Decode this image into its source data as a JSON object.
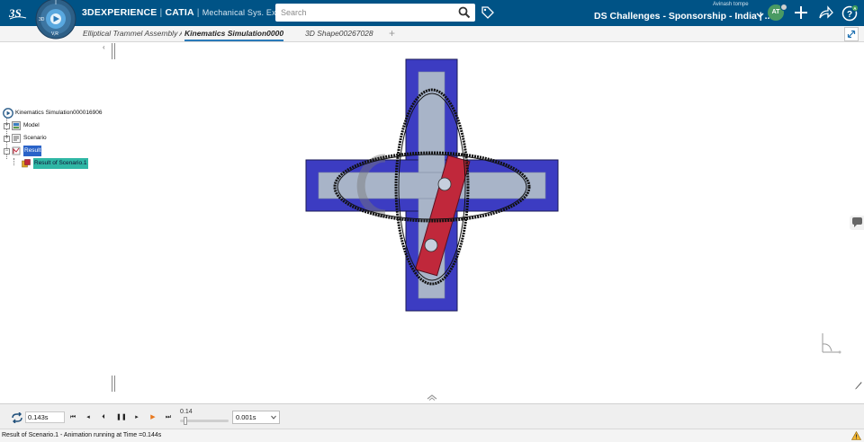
{
  "header": {
    "brand_bold": "3DEXPERIENCE",
    "brand_app": "CATIA",
    "brand_role": "Mechanical Sys. Experi...",
    "compass_text_top": "3D",
    "compass_text_bottom": "V,R",
    "search_placeholder": "Search",
    "user_name": "Avinash tompe",
    "space_title": "DS Challenges - Sponsorship - India | ...",
    "avatar_initials": "AT",
    "icons": [
      "compass-icon",
      "search-icon",
      "tag-icon",
      "plus-icon",
      "share-icon",
      "help-icon"
    ]
  },
  "tabs": [
    {
      "label": "Elliptical Trammel Assembly A",
      "active": false
    },
    {
      "label": "Kinematics Simulation00000",
      "active": true
    },
    {
      "label": "3D Shape00267028",
      "active": false
    }
  ],
  "tree": {
    "root": "Kinematics Simulation000016906",
    "items": [
      {
        "label": "Model"
      },
      {
        "label": "Scenario"
      },
      {
        "label": "Result",
        "selected": true
      },
      {
        "label": "Result of Scenario.1",
        "selected": true
      }
    ]
  },
  "player": {
    "time_value": "0.143s",
    "slider_value": "0.14",
    "slider_fraction": 0.07,
    "step_value": "0.001s",
    "buttons": [
      "first-frame",
      "step-back",
      "play-reverse",
      "pause",
      "play-forward",
      "step-forward",
      "last-frame"
    ]
  },
  "status": {
    "text": "Result of Scenario.1 - Animation running at Time =0.144s"
  },
  "colors": {
    "topbar": "#005386",
    "frame_blue": "#3c3cc2",
    "slot_grey": "#a8b4c8",
    "link_red": "#c0283b",
    "tree_selection": "#2a63c8"
  }
}
